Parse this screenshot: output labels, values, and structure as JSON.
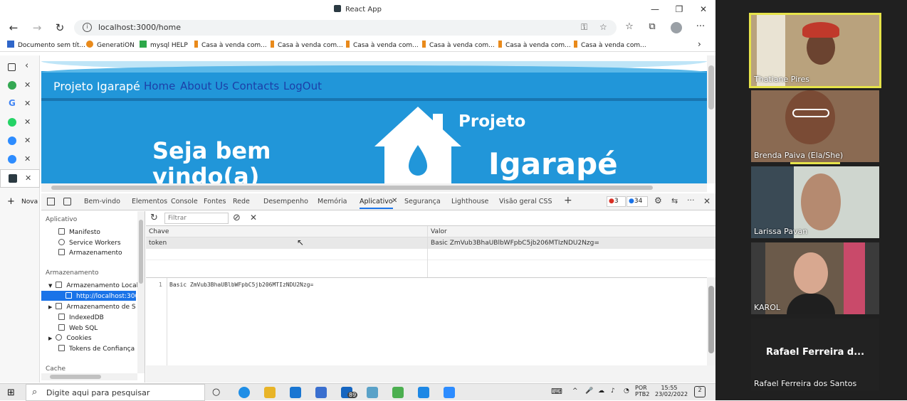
{
  "window": {
    "title": "React App",
    "min": "—",
    "restore": "❐",
    "close": "✕"
  },
  "nav": {
    "back": "←",
    "forward": "→",
    "reload": "↻",
    "url": "localhost:3000/home",
    "menu": "···"
  },
  "bookmarks": [
    {
      "label": "Documento sem tít...",
      "color": "#2f66c9"
    },
    {
      "label": "GeneratiON",
      "color": "#e98a1b"
    },
    {
      "label": "mysql HELP",
      "color": "#2da84a"
    },
    {
      "label": "Casa à venda com...",
      "color": "#e98a1b"
    },
    {
      "label": "Casa à venda com...",
      "color": "#e98a1b"
    },
    {
      "label": "Casa à venda com...",
      "color": "#e98a1b"
    },
    {
      "label": "Casa à venda com...",
      "color": "#e98a1b"
    },
    {
      "label": "Casa à venda com...",
      "color": "#e98a1b"
    },
    {
      "label": "Casa à venda com...",
      "color": "#e98a1b"
    }
  ],
  "page": {
    "brand": "Projeto Igarapé",
    "links": [
      "Home",
      "About Us",
      "Contacts",
      "LogOut"
    ],
    "hero": "Seja bem vindo(a)",
    "logo_top": "Projeto",
    "logo_bottom": "Igarapé"
  },
  "sidebar_tabs": {
    "new_tab": "Nova"
  },
  "devtools": {
    "tabs": [
      "Bem-vindo",
      "Elementos",
      "Console",
      "Fontes",
      "Rede",
      "Desempenho",
      "Memória",
      "Aplicativo",
      "Segurança",
      "Lighthouse",
      "Visão geral CSS"
    ],
    "active_tab": "Aplicativo",
    "errors": "3",
    "messages": "34",
    "filter_placeholder": "Filtrar",
    "sidebar": {
      "app_header": "Aplicativo",
      "app_items": [
        "Manifesto",
        "Service Workers",
        "Armazenamento"
      ],
      "storage_header": "Armazenamento",
      "local": "Armazenamento Local",
      "local_child": "http://localhost:3000",
      "session": "Armazenamento de Sessão",
      "storage_items": [
        "IndexedDB",
        "Web SQL",
        "Cookies",
        "Tokens de Confiança"
      ],
      "cache_header": "Cache"
    },
    "grid": {
      "col_key": "Chave",
      "col_value": "Valor",
      "row_key": "token",
      "row_value": "Basic ZmVub3BhaUBlbWFpbC5jb206MTIzNDU2Nzg="
    },
    "preview": {
      "line": "1",
      "code": "Basic ZmVub3BhaUBlbWFpbC5jb206MTIzNDU2Nzg="
    }
  },
  "participants": [
    {
      "name": "Thatiane Pires",
      "bg": "#b9a27d",
      "face": "#6b4330",
      "active": true
    },
    {
      "name": "Brenda Paiva (Ela/She)",
      "bg": "#8a6a52",
      "face": "#7a4b35",
      "active": false
    },
    {
      "name": "Larissa Pavan",
      "bg": "#cfd6cf",
      "face": "#b58a70",
      "active": false
    },
    {
      "name": "KAROL",
      "bg": "#3b3b3b",
      "face": "#d8a890",
      "active": false
    }
  ],
  "participant_text": {
    "big": "Rafael Ferreira d...",
    "full": "Rafael Ferreira dos Santos"
  },
  "taskbar": {
    "search": "Digite aqui para pesquisar",
    "mail_badge": "89",
    "lang1": "POR",
    "lang2": "PTB2",
    "time": "15:55",
    "date": "23/02/2022",
    "notif": "2"
  }
}
